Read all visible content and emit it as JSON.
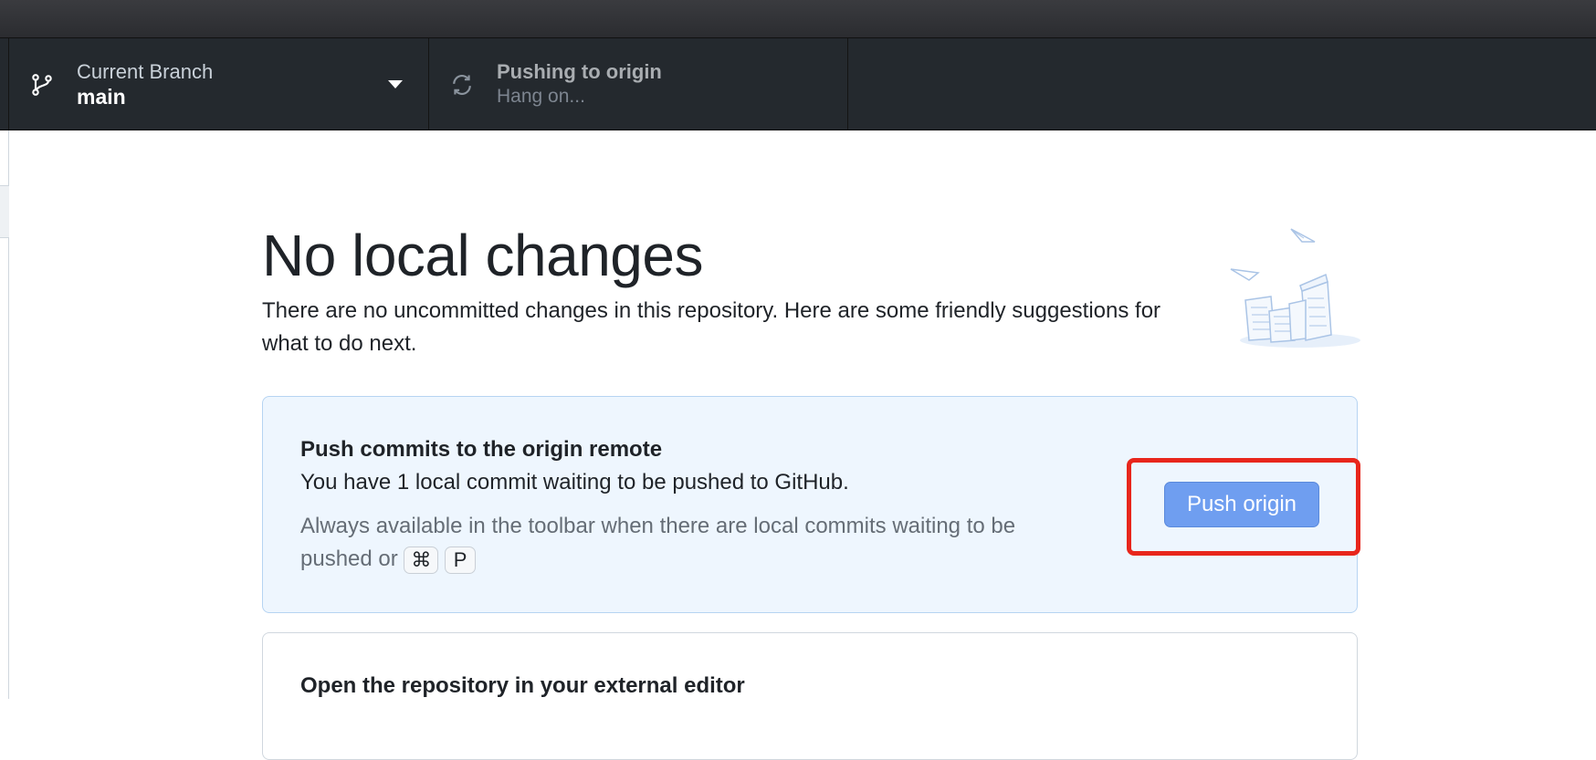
{
  "toolbar": {
    "branch": {
      "label": "Current Branch",
      "value": "main",
      "icon": "git-branch-icon"
    },
    "push": {
      "label": "Pushing to origin",
      "value": "Hang on...",
      "icon": "sync-icon"
    }
  },
  "main": {
    "heading": "No local changes",
    "subtext": "There are no uncommitted changes in this repository. Here are some friendly suggestions for what to do next.",
    "illustration": "paper-stacks-illustration"
  },
  "push_card": {
    "title": "Push commits to the origin remote",
    "description": "You have 1 local commit waiting to be pushed to GitHub.",
    "hint": "Always available in the toolbar when there are local commits waiting to be pushed or",
    "shortcut_keys": [
      "⌘",
      "P"
    ],
    "button_label": "Push origin"
  },
  "editor_card": {
    "title": "Open the repository in your external editor"
  },
  "colors": {
    "toolbar_bg": "#24292e",
    "card_bg": "#eef6fe",
    "button_bg": "#6f9ef0",
    "highlight": "#e8261c"
  }
}
